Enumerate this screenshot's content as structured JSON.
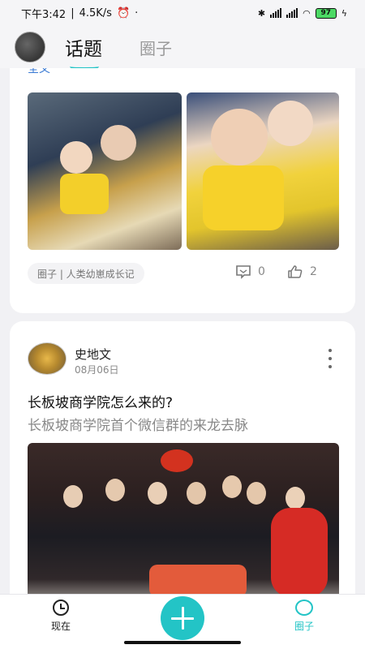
{
  "status_bar": {
    "time": "下午3:42",
    "speed": "4.5K/s",
    "battery": "97"
  },
  "top_nav": {
    "tabs": [
      {
        "label": "话题",
        "active": true
      },
      {
        "label": "圈子",
        "active": false
      }
    ]
  },
  "feed": {
    "posts": [
      {
        "full_text_link": "全文",
        "tag": "圈子 | 人类幼崽成长记",
        "comments": "0",
        "likes": "2"
      },
      {
        "author": "史地文",
        "date": "08月06日",
        "title": "长板坡商学院怎么来的?",
        "subtitle": "长板坡商学院首个微信群的来龙去脉"
      }
    ]
  },
  "bottom_nav": {
    "items": [
      {
        "label": "现在",
        "icon": "clock-icon"
      },
      {
        "label": "圈子",
        "icon": "circle-icon"
      }
    ],
    "accent": "#23c4c6"
  }
}
